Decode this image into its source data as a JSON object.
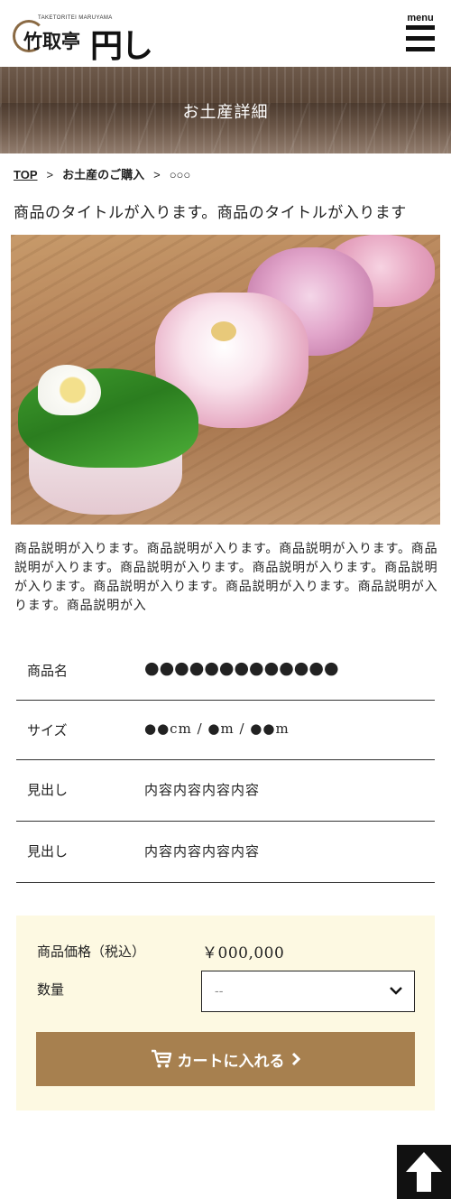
{
  "header": {
    "logo_sub": "TAKETORITEI MARUYAMA",
    "logo_kanji": "竹取亭",
    "logo_brush": "円し",
    "menu_label": "menu"
  },
  "hero": {
    "title": "お土産詳細"
  },
  "breadcrumb": {
    "items": [
      "TOP",
      "お土産のご購入",
      "○○○"
    ],
    "separator": ">"
  },
  "product": {
    "title": "商品のタイトルが入ります。商品のタイトルが入ります",
    "description": "商品説明が入ります。商品説明が入ります。商品説明が入ります。商品説明が入ります。商品説明が入ります。商品説明が入ります。商品説明が入ります。商品説明が入ります。商品説明が入ります。商品説明が入ります。商品説明が入"
  },
  "specs": [
    {
      "label": "商品名",
      "value": "●●●●●●●●●●●●●"
    },
    {
      "label": "サイズ",
      "value": "●●cm / ●m / ●●m"
    },
    {
      "label": "見出し",
      "value": "内容内容内容内容"
    },
    {
      "label": "見出し",
      "value": "内容内容内容内容"
    }
  ],
  "purchase": {
    "price_label": "商品価格（税込）",
    "price_value": "￥000,000",
    "qty_label": "数量",
    "qty_value": "--",
    "cart_label": "カートに入れる"
  },
  "colors": {
    "accent": "#a7804f",
    "purchase_bg": "#fdf9e2",
    "pagetop_bg": "#111111"
  },
  "icons": {
    "menu": "hamburger-icon",
    "cart": "cart-icon",
    "chevron": "chevron-down-icon",
    "arrow_right": "chevron-right-icon",
    "pagetop": "arrow-up-icon"
  }
}
